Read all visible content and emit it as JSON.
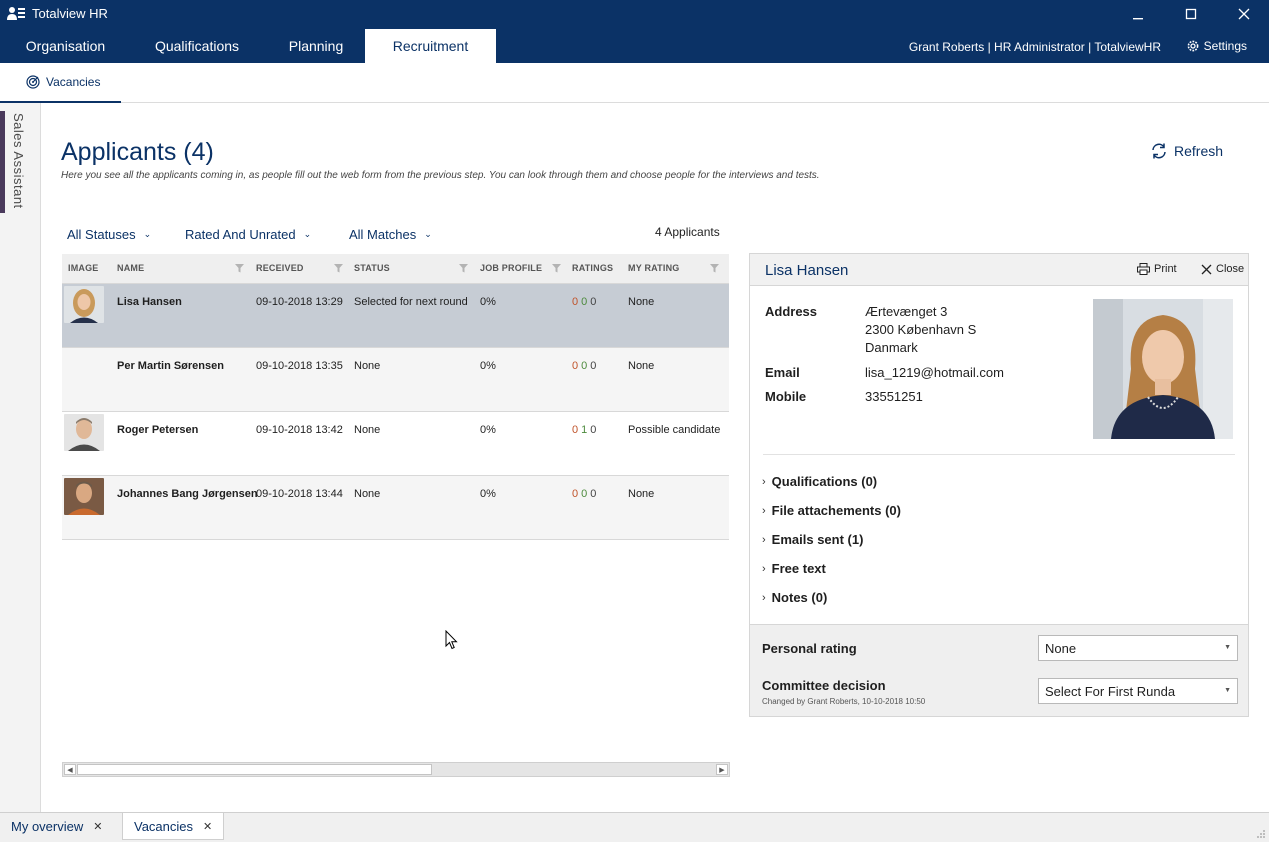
{
  "app": {
    "title": "Totalview HR"
  },
  "nav": {
    "tabs": [
      "Organisation",
      "Qualifications",
      "Planning",
      "Recruitment"
    ],
    "active": "Recruitment",
    "user": "Grant Roberts  |  HR Administrator  |  TotalviewHR",
    "settings": "Settings"
  },
  "subtabs": {
    "vacancies": "Vacancies"
  },
  "sidebar": {
    "label": "Sales Assistant"
  },
  "page": {
    "title": "Applicants (4)",
    "subtitle": "Here you see all the applicants coming in, as people fill out the web form from the previous step. You can look through them and choose people for the interviews and tests.",
    "refresh": "Refresh"
  },
  "filters": {
    "status": "All Statuses",
    "rating": "Rated And Unrated",
    "matches": "All Matches",
    "count": "4 Applicants"
  },
  "table": {
    "headers": [
      "IMAGE",
      "NAME",
      "RECEIVED",
      "STATUS",
      "JOB PROFILE",
      "RATINGS",
      "MY RATING"
    ],
    "rows": [
      {
        "name": "Lisa Hansen",
        "received": "09-10-2018 13:29",
        "status": "Selected for next round",
        "job_profile": "0%",
        "ratings": [
          "0",
          "0",
          "0"
        ],
        "my_rating": "None",
        "has_image": true
      },
      {
        "name": "Per Martin  Sørensen",
        "received": "09-10-2018 13:35",
        "status": "None",
        "job_profile": "0%",
        "ratings": [
          "0",
          "0",
          "0"
        ],
        "my_rating": "None",
        "has_image": false
      },
      {
        "name": "Roger Petersen",
        "received": "09-10-2018 13:42",
        "status": "None",
        "job_profile": "0%",
        "ratings": [
          "0",
          "1",
          "0"
        ],
        "my_rating": "Possible candidate",
        "has_image": true
      },
      {
        "name": "Johannes Bang Jørgensen",
        "received": "09-10-2018 13:44",
        "status": "None",
        "job_profile": "0%",
        "ratings": [
          "0",
          "0",
          "0"
        ],
        "my_rating": "None",
        "has_image": true
      }
    ]
  },
  "detail": {
    "name": "Lisa Hansen",
    "print": "Print",
    "close": "Close",
    "address_label": "Address",
    "address": [
      "Ærtevænget 3",
      "2300 København S",
      "Danmark"
    ],
    "email_label": "Email",
    "email": "lisa_1219@hotmail.com",
    "mobile_label": "Mobile",
    "mobile": "33551251",
    "sections": [
      "Qualifications (0)",
      "File attachements (0)",
      "Emails sent (1)",
      "Free text",
      "Notes (0)"
    ],
    "personal_rating_label": "Personal rating",
    "personal_rating_value": "None",
    "committee_label": "Committee decision",
    "committee_changed": "Changed by Grant Roberts, 10-10-2018 10:50",
    "committee_value": "Select For First Runda"
  },
  "bottom_tabs": [
    "My overview",
    "Vacancies"
  ],
  "colors": {
    "brand": "#0b3266",
    "selected_row": "#c6ccd4"
  }
}
